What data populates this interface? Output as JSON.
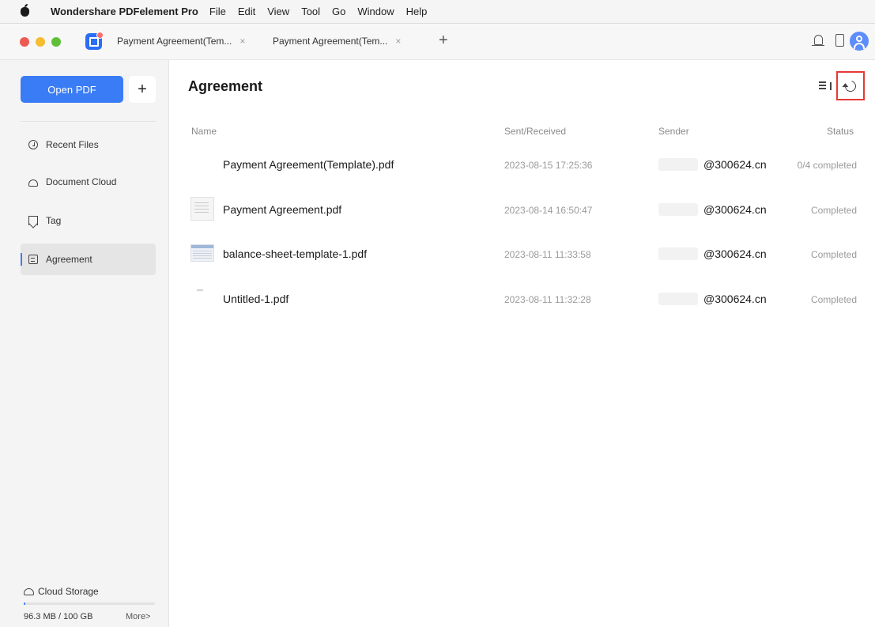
{
  "menubar": {
    "app_name": "Wondershare PDFelement Pro",
    "items": [
      "File",
      "Edit",
      "View",
      "Tool",
      "Go",
      "Window",
      "Help"
    ]
  },
  "tabs": [
    {
      "label": "Payment Agreement(Tem...",
      "close": "×"
    },
    {
      "label": "Payment Agreement(Tem...",
      "close": "×"
    }
  ],
  "tab_add": "+",
  "sidebar": {
    "open_pdf": "Open PDF",
    "plus": "+",
    "items": [
      {
        "label": "Recent Files",
        "icon": "clock-icon"
      },
      {
        "label": "Document Cloud",
        "icon": "cloud-icon"
      },
      {
        "label": "Tag",
        "icon": "tag-icon"
      },
      {
        "label": "Agreement",
        "icon": "document-icon",
        "active": true
      }
    ],
    "cloud_storage": "Cloud Storage",
    "storage_used": "96.3 MB / 100 GB",
    "storage_fraction": 0.001,
    "more": "More>"
  },
  "main": {
    "title": "Agreement",
    "columns": {
      "name": "Name",
      "sent": "Sent/Received",
      "sender": "Sender",
      "status": "Status"
    },
    "rows": [
      {
        "name": "Payment Agreement(Template).pdf",
        "date": "2023-08-15 17:25:36",
        "sender": "@300624.cn",
        "status": "0/4 completed",
        "thumb": "none"
      },
      {
        "name": "Payment Agreement.pdf",
        "date": "2023-08-14 16:50:47",
        "sender": "@300624.cn",
        "status": "Completed",
        "thumb": "document"
      },
      {
        "name": "balance-sheet-template-1.pdf",
        "date": "2023-08-11 11:33:58",
        "sender": "@300624.cn",
        "status": "Completed",
        "thumb": "spreadsheet"
      },
      {
        "name": "Untitled-1.pdf",
        "date": "2023-08-11 11:32:28",
        "sender": "@300624.cn",
        "status": "Completed",
        "thumb": "blank"
      }
    ]
  },
  "colors": {
    "accent": "#3a7cf5",
    "highlight": "#e53935"
  }
}
